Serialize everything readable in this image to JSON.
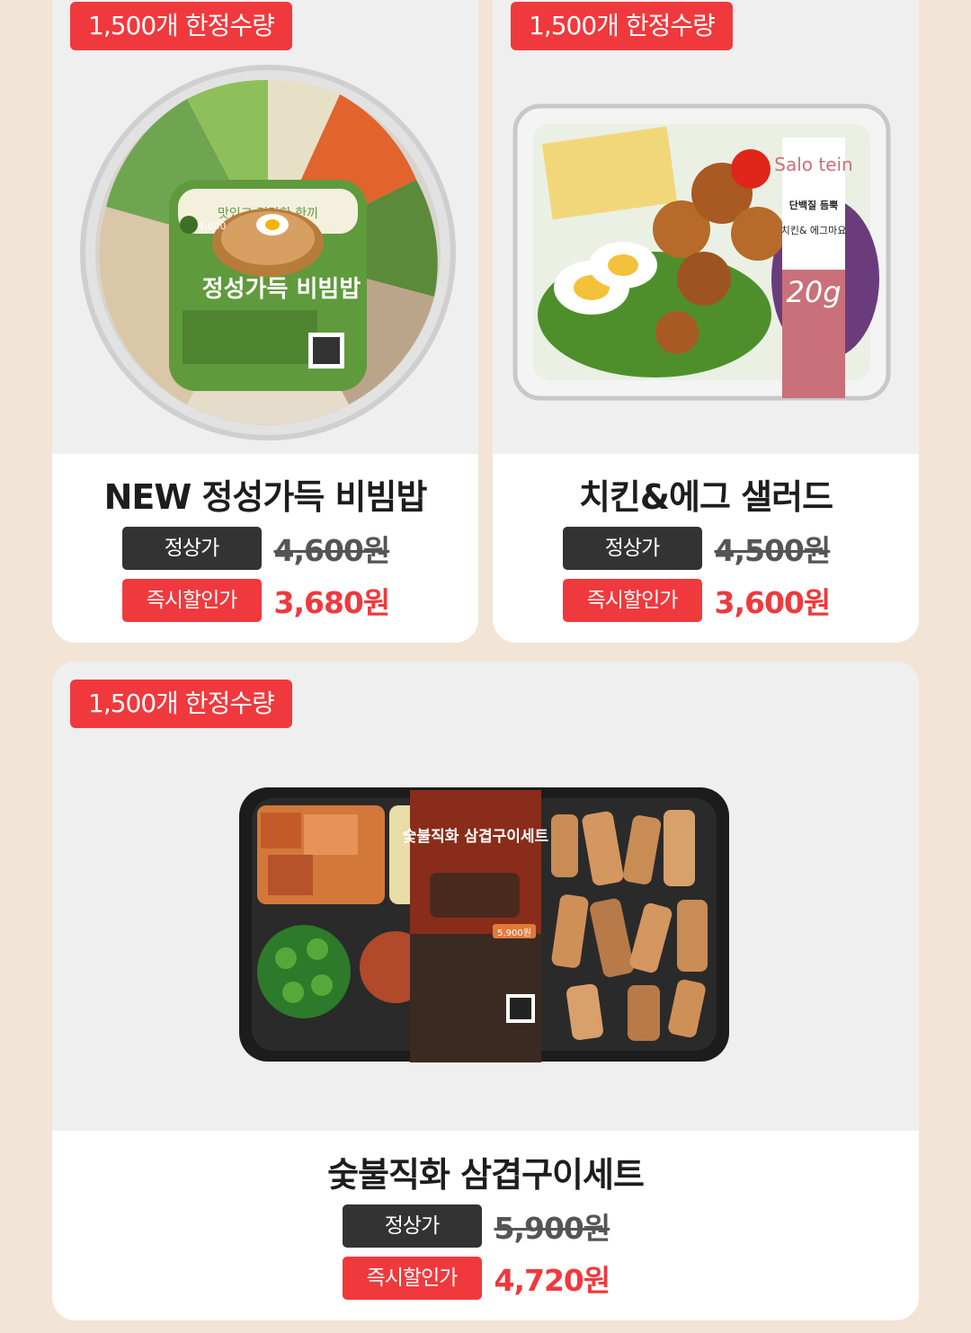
{
  "products": [
    {
      "badge": "1,500개 한정수량",
      "name": "NEW 정성가득 비빔밥",
      "regular_label": "정상가",
      "regular_price": "4,600원",
      "sale_label": "즉시할인가",
      "sale_price": "3,680원",
      "package_text": {
        "tagline": "맛있고 건강한 한끼",
        "product_name": "정성가득 비빔밥",
        "price_tag": "4,600"
      }
    },
    {
      "badge": "1,500개 한정수량",
      "name": "치킨&에그 샐러드",
      "regular_label": "정상가",
      "regular_price": "4,500원",
      "sale_label": "즉시할인가",
      "sale_price": "3,600원",
      "package_text": {
        "brand": "Salo tein",
        "protein_label": "단백질 듬뿍",
        "product_name": "치킨& 에그마요",
        "protein_amount": "20g"
      }
    },
    {
      "badge": "1,500개 한정수량",
      "name": "숯불직화 삼겹구이세트",
      "regular_label": "정상가",
      "regular_price": "5,900원",
      "sale_label": "즉시할인가",
      "sale_price": "4,720원",
      "package_text": {
        "product_name": "숯불직화 삼겹구이세트",
        "price_tag": "5,900원"
      }
    }
  ],
  "colors": {
    "page_background": "#f2e5d6",
    "card_background": "#ffffff",
    "image_background": "#efefef",
    "accent_red": "#f0393d",
    "regular_label_bg": "#333333"
  }
}
